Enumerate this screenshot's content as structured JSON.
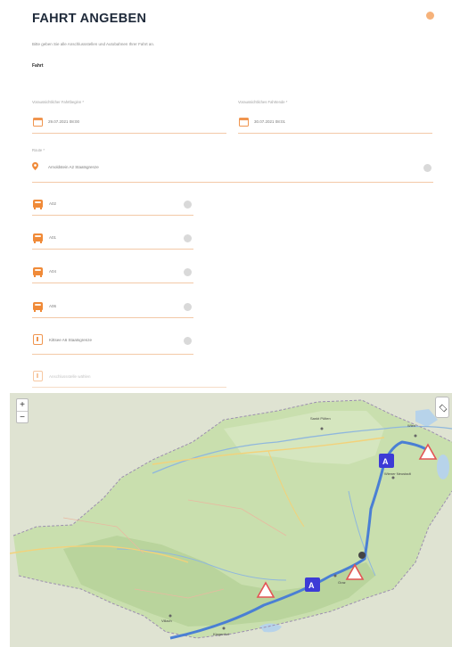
{
  "header": {
    "title": "FAHRT ANGEBEN"
  },
  "intro": "Bitte geben Sie alle Anschlussstellen und Autobahnen Ihrer Fahrt an.",
  "section_title": "Fahrt",
  "start_date": {
    "label": "Voraussichtlicher Fahrtbeginn *",
    "value": "29.07.2021 08:00"
  },
  "end_date": {
    "label": "Voraussichtliches Fahrtende *",
    "value": "30.07.2021 08:01"
  },
  "route": {
    "label": "Route *",
    "value": "Arnoldstein A2 Staatsgrenze"
  },
  "stops": [
    {
      "value": "A02"
    },
    {
      "value": "A01"
    },
    {
      "value": "A04"
    },
    {
      "value": "A06"
    }
  ],
  "exit_field": {
    "value": "Kittsee A6 Staatsgrenze"
  },
  "next_field": {
    "placeholder": "Anschlussstelle wählen"
  },
  "map": {
    "zoom_in": "+",
    "zoom_out": "−",
    "route_color": "#4a7fd4",
    "accent_color": "#f08a38",
    "marker_color": "#3d3bd6",
    "place_labels": [
      "Sankt Pölten",
      "Wiener Neustadt",
      "Klagenfurt",
      "Villach",
      "Graz",
      "Wien"
    ]
  }
}
